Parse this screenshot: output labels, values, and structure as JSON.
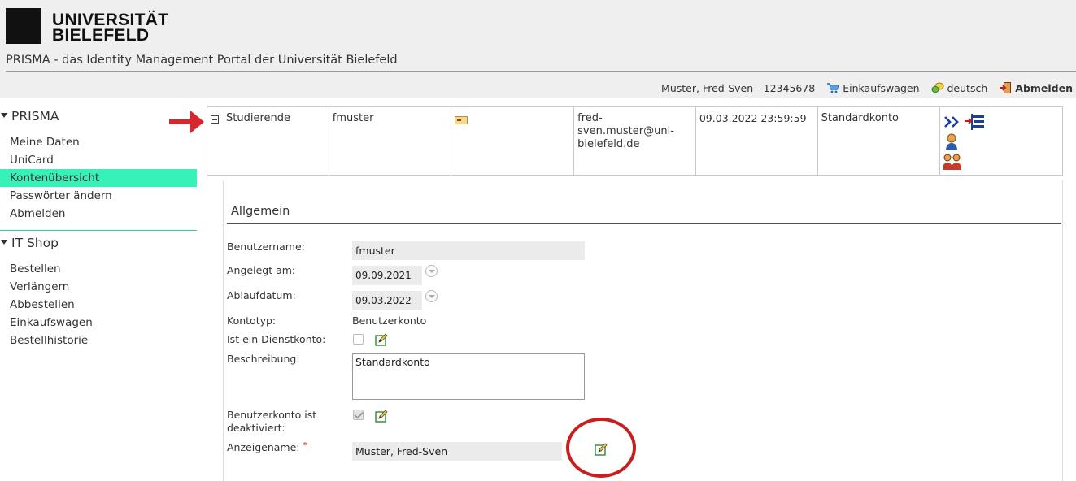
{
  "header": {
    "logo_line1": "UNIVERSITÄT",
    "logo_line2": "BIELEFELD",
    "portal_title": "PRISMA - das Identity Management Portal der Universität Bielefeld"
  },
  "userbar": {
    "user": "Muster, Fred-Sven - 12345678",
    "cart": "Einkaufswagen",
    "language": "deutsch",
    "logout": "Abmelden"
  },
  "sidebar": {
    "prisma": {
      "title": "PRISMA",
      "items": [
        "Meine Daten",
        "UniCard",
        "Kontenübersicht",
        "Passwörter ändern",
        "Abmelden"
      ],
      "active_index": 2
    },
    "itshop": {
      "title": "IT Shop",
      "items": [
        "Bestellen",
        "Verlängern",
        "Abbestellen",
        "Einkaufswagen",
        "Bestellhistorie"
      ]
    }
  },
  "account": {
    "type": "Studierende",
    "username": "fmuster",
    "email_line1": "fred-sven.muster@uni-",
    "email_line2": "bielefeld.de",
    "expiry": "09.03.2022 23:59:59",
    "description": "Standardkonto"
  },
  "details": {
    "section_title": "Allgemein",
    "labels": {
      "username": "Benutzername:",
      "created": "Angelegt am:",
      "expiry": "Ablaufdatum:",
      "account_type": "Kontotyp:",
      "service_account": "Ist ein Dienstkonto:",
      "description": "Beschreibung:",
      "deactivated_line1": "Benutzerkonto ist",
      "deactivated_line2": "deaktiviert:",
      "display_name": "Anzeigename:"
    },
    "values": {
      "username": "fmuster",
      "created": "09.09.2021",
      "expiry": "09.03.2022",
      "account_type": "Benutzerkonto",
      "description": "Standardkonto",
      "display_name": "Muster, Fred-Sven"
    },
    "required_marker": "*"
  },
  "colors": {
    "active_nav": "#37f2b8",
    "annotation_red": "#c81e1e",
    "header_bg": "#efefef"
  }
}
